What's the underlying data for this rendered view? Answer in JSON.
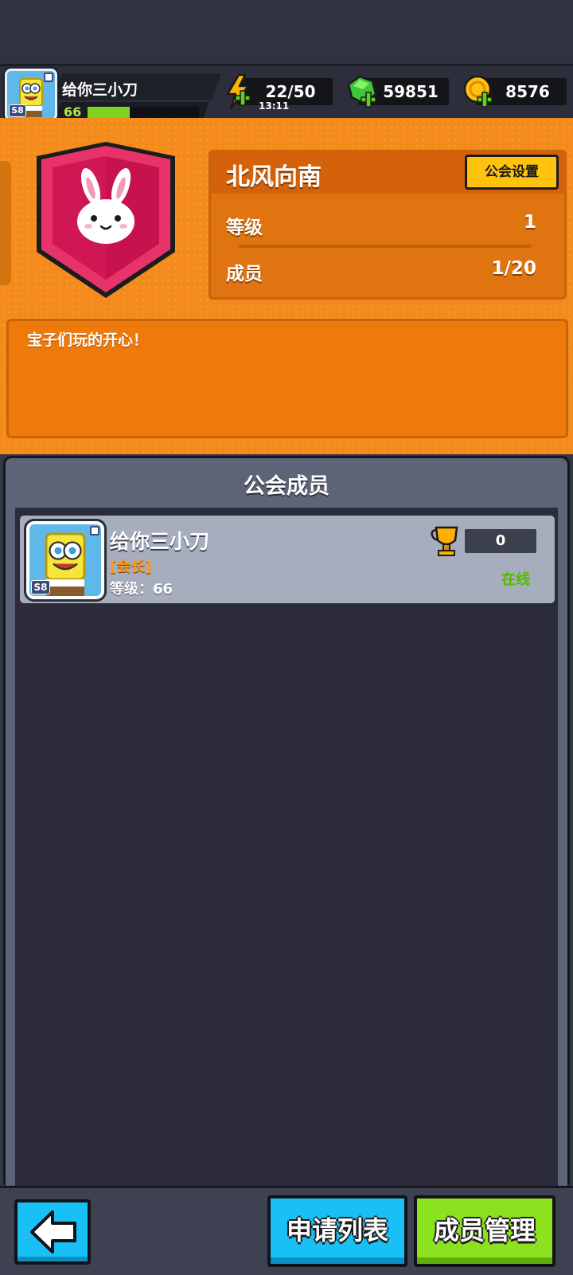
{
  "player": {
    "name": "给你三小刀",
    "level": "66",
    "badge": "S8",
    "xp_fraction": 0.38
  },
  "resources": {
    "energy": "22/50",
    "energy_timer": "13:11",
    "gems": "59851",
    "coins": "8576"
  },
  "guild": {
    "name": "北风向南",
    "settings_label": "公会设置",
    "level_label": "等级",
    "level_value": "1",
    "members_label": "成员",
    "members_value": "1/20",
    "motto": "宝子们玩的开心！"
  },
  "members_panel": {
    "title": "公会成员",
    "members": [
      {
        "name": "给你三小刀",
        "role": "[会长]",
        "level_text": "等级：66",
        "badge": "S8",
        "trophies": "0",
        "status": "在线"
      }
    ]
  },
  "bottom": {
    "apply_list": "申请列表",
    "manage_members": "成员管理"
  },
  "colors": {
    "guild_orange": "#f38a1a",
    "emblem_pink": "#e8336a",
    "online_green": "#56b800",
    "button_blue": "#18c0f5",
    "button_green": "#8de21f"
  }
}
